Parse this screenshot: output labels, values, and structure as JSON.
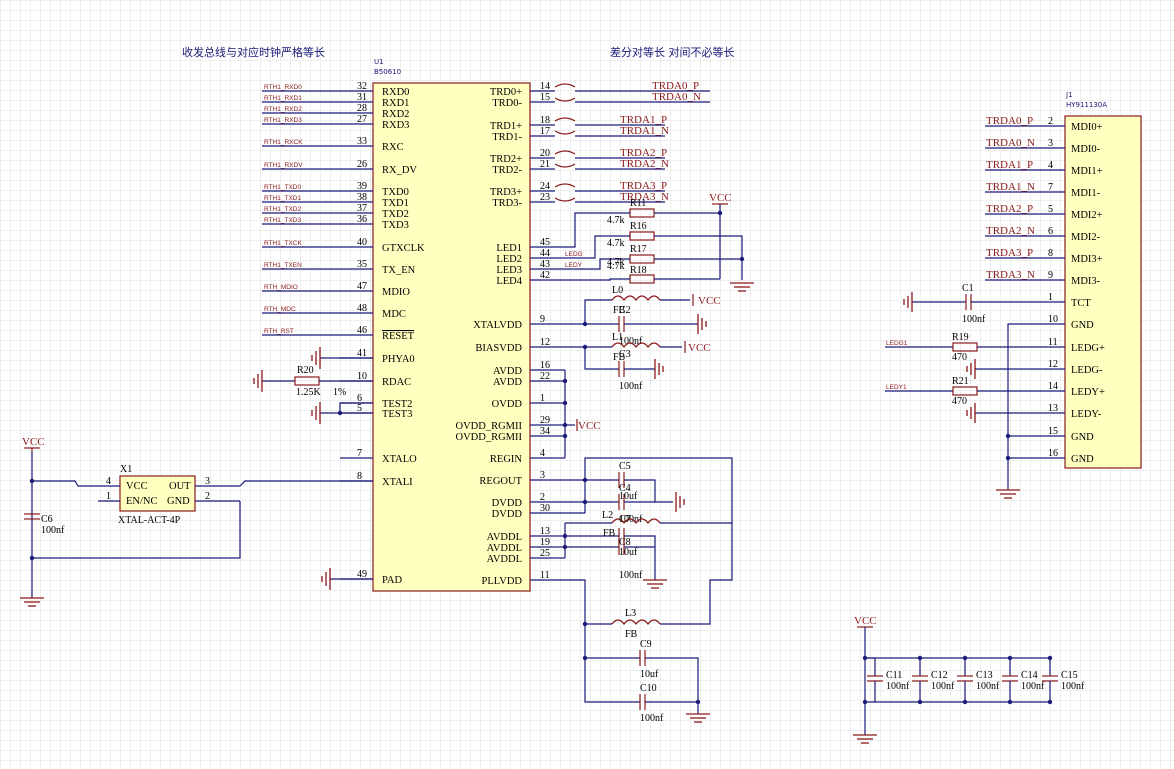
{
  "notes": {
    "left": "收发总线与对应时钟严格等长",
    "right": "差分对等长 对间不必等长"
  },
  "u1": {
    "designator": "U1",
    "part": "B50610",
    "left_pins": [
      {
        "num": "32",
        "name": "RXD0",
        "net": "RTH1_RXD0"
      },
      {
        "num": "31",
        "name": "RXD1",
        "net": "RTH1_RXD1"
      },
      {
        "num": "28",
        "name": "RXD2",
        "net": "RTH1_RXD2"
      },
      {
        "num": "27",
        "name": "RXD3",
        "net": "RTH1_RXD3"
      },
      {
        "num": "33",
        "name": "RXC",
        "net": "RTH1_RXCK"
      },
      {
        "num": "26",
        "name": "RX_DV",
        "net": "RTH1_RXDV"
      },
      {
        "num": "39",
        "name": "TXD0",
        "net": "RTH1_TXD0"
      },
      {
        "num": "38",
        "name": "TXD1",
        "net": "RTH1_TXD1"
      },
      {
        "num": "37",
        "name": "TXD2",
        "net": "RTH1_TXD2"
      },
      {
        "num": "36",
        "name": "TXD3",
        "net": "RTH1_TXD3"
      },
      {
        "num": "40",
        "name": "GTXCLK",
        "net": "RTH1_TXCK"
      },
      {
        "num": "35",
        "name": "TX_EN",
        "net": "RTH1_TXEN"
      },
      {
        "num": "47",
        "name": "MDIO",
        "net": "RTH_MDIO"
      },
      {
        "num": "48",
        "name": "MDC",
        "net": "RTH_MDC"
      },
      {
        "num": "46",
        "name": "RESET",
        "net": "RTH_RST"
      },
      {
        "num": "41",
        "name": "PHYA0",
        "net": ""
      },
      {
        "num": "10",
        "name": "RDAC",
        "net": ""
      },
      {
        "num": "6",
        "name": "TEST2",
        "net": ""
      },
      {
        "num": "5",
        "name": "TEST3",
        "net": ""
      },
      {
        "num": "7",
        "name": "XTALO",
        "net": ""
      },
      {
        "num": "8",
        "name": "XTALI",
        "net": ""
      },
      {
        "num": "49",
        "name": "PAD",
        "net": ""
      }
    ],
    "right_pins": [
      {
        "num": "14",
        "name": "TRD0+",
        "net": "TRDA0_P"
      },
      {
        "num": "15",
        "name": "TRD0-",
        "net": "TRDA0_N"
      },
      {
        "num": "18",
        "name": "TRD1+",
        "net": "TRDA1_P"
      },
      {
        "num": "17",
        "name": "TRD1-",
        "net": "TRDA1_N"
      },
      {
        "num": "20",
        "name": "TRD2+",
        "net": "TRDA2_P"
      },
      {
        "num": "21",
        "name": "TRD2-",
        "net": "TRDA2_N"
      },
      {
        "num": "24",
        "name": "TRD3+",
        "net": "TRDA3_P"
      },
      {
        "num": "23",
        "name": "TRD3-",
        "net": "TRDA3_N"
      },
      {
        "num": "45",
        "name": "LED1",
        "net": ""
      },
      {
        "num": "44",
        "name": "LED2",
        "net": "LEDG"
      },
      {
        "num": "43",
        "name": "LED3",
        "net": "LEDY"
      },
      {
        "num": "42",
        "name": "LED4",
        "net": ""
      },
      {
        "num": "9",
        "name": "XTALVDD",
        "net": ""
      },
      {
        "num": "12",
        "name": "BIASVDD",
        "net": ""
      },
      {
        "num": "16",
        "name": "AVDD",
        "net": ""
      },
      {
        "num": "22",
        "name": "AVDD",
        "net": ""
      },
      {
        "num": "1",
        "name": "OVDD",
        "net": ""
      },
      {
        "num": "29",
        "name": "OVDD_RGMII",
        "net": ""
      },
      {
        "num": "34",
        "name": "OVDD_RGMII",
        "net": ""
      },
      {
        "num": "4",
        "name": "REGIN",
        "net": ""
      },
      {
        "num": "3",
        "name": "REGOUT",
        "net": ""
      },
      {
        "num": "2",
        "name": "DVDD",
        "net": ""
      },
      {
        "num": "30",
        "name": "DVDD",
        "net": ""
      },
      {
        "num": "13",
        "name": "AVDDL",
        "net": ""
      },
      {
        "num": "19",
        "name": "AVDDL",
        "net": ""
      },
      {
        "num": "25",
        "name": "AVDDL",
        "net": ""
      },
      {
        "num": "11",
        "name": "PLLVDD",
        "net": ""
      }
    ]
  },
  "j1": {
    "designator": "J1",
    "part": "HY911130A",
    "pins": [
      {
        "num": "2",
        "name": "MDI0+",
        "net": "TRDA0_P"
      },
      {
        "num": "3",
        "name": "MDI0-",
        "net": "TRDA0_N"
      },
      {
        "num": "4",
        "name": "MDI1+",
        "net": "TRDA1_P"
      },
      {
        "num": "7",
        "name": "MDI1-",
        "net": "TRDA1_N"
      },
      {
        "num": "5",
        "name": "MDI2+",
        "net": "TRDA2_P"
      },
      {
        "num": "6",
        "name": "MDI2-",
        "net": "TRDA2_N"
      },
      {
        "num": "8",
        "name": "MDI3+",
        "net": "TRDA3_P"
      },
      {
        "num": "9",
        "name": "MDI3-",
        "net": "TRDA3_N"
      },
      {
        "num": "1",
        "name": "TCT",
        "net": ""
      },
      {
        "num": "10",
        "name": "GND",
        "net": ""
      },
      {
        "num": "11",
        "name": "LEDG+",
        "net": "LEDG1"
      },
      {
        "num": "12",
        "name": "LEDG-",
        "net": ""
      },
      {
        "num": "14",
        "name": "LEDY+",
        "net": "LEDY1"
      },
      {
        "num": "13",
        "name": "LEDY-",
        "net": ""
      },
      {
        "num": "15",
        "name": "GND",
        "net": ""
      },
      {
        "num": "16",
        "name": "GND",
        "net": ""
      }
    ]
  },
  "x1": {
    "designator": "X1",
    "part": "XTAL-ACT-4P",
    "pins": [
      {
        "num": "4",
        "name": "VCC"
      },
      {
        "num": "1",
        "name": "EN/NC"
      },
      {
        "num": "3",
        "name": "OUT"
      },
      {
        "num": "2",
        "name": "GND"
      }
    ]
  },
  "power": {
    "vcc": "VCC"
  },
  "components": {
    "r11": {
      "des": "R11",
      "val": "4.7k"
    },
    "r16": {
      "des": "R16",
      "val": "4.7k"
    },
    "r17": {
      "des": "R17",
      "val": "4.7k"
    },
    "r18": {
      "des": "R18",
      "val": "4.7k"
    },
    "r19": {
      "des": "R19",
      "val": "470"
    },
    "r21": {
      "des": "R21",
      "val": "470"
    },
    "r20": {
      "des": "R20",
      "val": "1.25K",
      "tol": "1%"
    },
    "l0": {
      "des": "L0",
      "val": "FB"
    },
    "l1": {
      "des": "L1",
      "val": "FB"
    },
    "l2": {
      "des": "L2",
      "val": "FB"
    },
    "l3": {
      "des": "L3",
      "val": "FB"
    },
    "c1": {
      "des": "C1",
      "val": "100nf"
    },
    "c2": {
      "des": "C2",
      "val": "100nf"
    },
    "c3": {
      "des": "C3",
      "val": "100nf"
    },
    "c4": {
      "des": "C4",
      "val": "100nf"
    },
    "c5": {
      "des": "C5",
      "val": "10uf"
    },
    "c6": {
      "des": "C6",
      "val": "100nf"
    },
    "c7": {
      "des": "C7",
      "val": "100nf"
    },
    "c8": {
      "des": "C8",
      "val": "10uf"
    },
    "c9": {
      "des": "C9",
      "val": "10uf"
    },
    "c10": {
      "des": "C10",
      "val": "100nf"
    },
    "c11": {
      "des": "C11",
      "val": "100nf"
    },
    "c12": {
      "des": "C12",
      "val": "100nf"
    },
    "c13": {
      "des": "C13",
      "val": "100nf"
    },
    "c14": {
      "des": "C14",
      "val": "100nf"
    },
    "c15": {
      "des": "C15",
      "val": "100nf"
    }
  }
}
